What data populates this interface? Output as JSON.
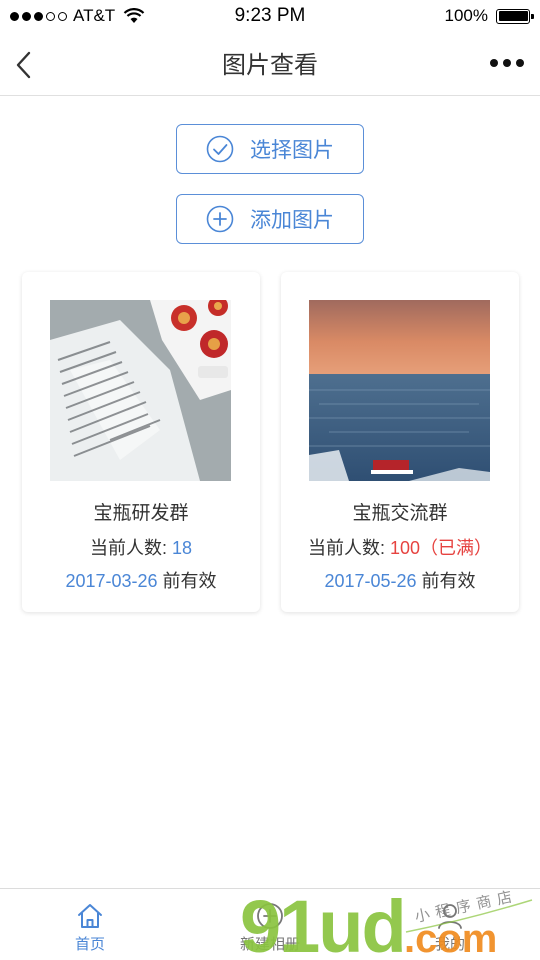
{
  "status_bar": {
    "carrier": "AT&T",
    "time": "9:23 PM",
    "battery": "100%",
    "signal_bars_filled": 3,
    "signal_bars_total": 5,
    "battery_level": 1.0
  },
  "nav": {
    "title": "图片查看",
    "back_icon": "chevron-left-icon",
    "more_icon": "more-dots-icon"
  },
  "actions": {
    "select_label": "选择图片",
    "select_icon": "check-circle-icon",
    "add_label": "添加图片",
    "add_icon": "plus-circle-icon"
  },
  "cards": [
    {
      "title": "宝瓶研发群",
      "count_label": "当前人数:",
      "count_value": "18",
      "date": "2017-03-26",
      "date_suffix": "前有效"
    },
    {
      "title": "宝瓶交流群",
      "count_label": "当前人数:",
      "count_value": "100（已满）",
      "date": "2017-05-26",
      "date_suffix": "前有效"
    }
  ],
  "tabs": [
    {
      "label": "首页",
      "icon": "home-icon",
      "active": true
    },
    {
      "label": "新建相册",
      "icon": "plus-circle-icon",
      "active": false
    },
    {
      "label": "我的",
      "icon": "user-icon",
      "active": false
    }
  ],
  "watermark": {
    "logo_text": "91ud",
    "domain": ".com",
    "tagline": "小程序商店"
  },
  "colors": {
    "accent": "#4a86d6",
    "warning": "#e64340",
    "watermark_green": "#8ac43f",
    "watermark_orange": "#f08c1f"
  }
}
